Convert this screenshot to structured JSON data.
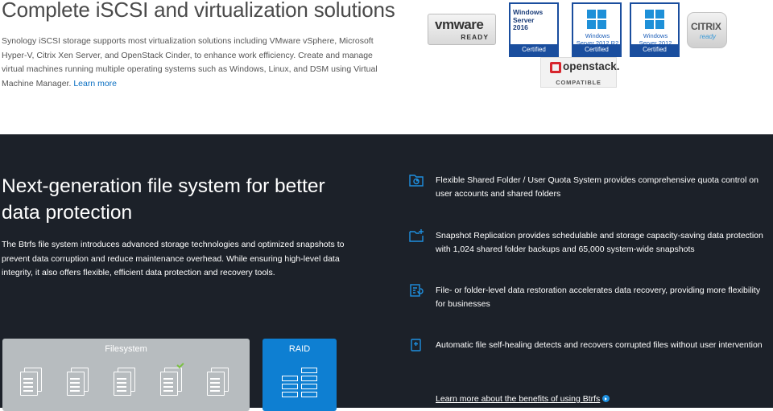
{
  "iscsi": {
    "title": "Complete iSCSI and virtualization solutions",
    "description": "Synology iSCSI storage supports most virtualization solutions including VMware vSphere, Microsoft Hyper-V, Citrix Xen Server, and OpenStack Cinder, to enhance work efficiency. Create and manage virtual machines running multiple operating systems such as Windows, Linux, and DSM using Virtual Machine Manager.",
    "learn_more": "Learn more",
    "badges": {
      "vmware": {
        "name": "vmware",
        "sub": "READY"
      },
      "win2016": {
        "line1": "Windows",
        "line2": "Server",
        "line3": "2016",
        "cert": "Certified"
      },
      "win2012r2": {
        "line1": "Windows",
        "line2": "Server 2012 R2",
        "cert": "Certified"
      },
      "win2012": {
        "line1": "Windows",
        "line2": "Server 2012",
        "cert": "Certified"
      },
      "citrix": {
        "name": "CITRIX",
        "sub": "ready"
      },
      "openstack": {
        "name": "openstack.",
        "sub": "COMPATIBLE"
      }
    }
  },
  "btrfs": {
    "title": "Next-generation file system for better data protection",
    "description": "The Btrfs file system introduces advanced storage technologies and optimized snapshots to prevent data corruption and reduce maintenance overhead. While ensuring high-level data integrity, it also offers flexible, efficient data protection and recovery tools.",
    "diagram": {
      "filesystem_label": "Filesystem",
      "raid_label": "RAID"
    },
    "features": [
      {
        "icon": "shared-folder-quota-icon",
        "text": "Flexible Shared Folder / User Quota System provides comprehensive quota control on user accounts and shared folders"
      },
      {
        "icon": "snapshot-replication-icon",
        "text": "Snapshot Replication provides schedulable and storage capacity-saving data protection with 1,024 shared folder backups and 65,000 system-wide snapshots"
      },
      {
        "icon": "data-restoration-icon",
        "text": "File- or folder-level data restoration accelerates data recovery, providing more flexibility for businesses"
      },
      {
        "icon": "self-healing-icon",
        "text": "Automatic file self-healing detects and recovers corrupted files without user intervention"
      }
    ],
    "learn_more": "Learn more about the benefits of using Btrfs"
  },
  "colors": {
    "accent": "#1e90e0",
    "dark_bg": "#1c2129",
    "raid_blue": "#0e7fd2",
    "fs_gray": "#b7bcbf"
  }
}
